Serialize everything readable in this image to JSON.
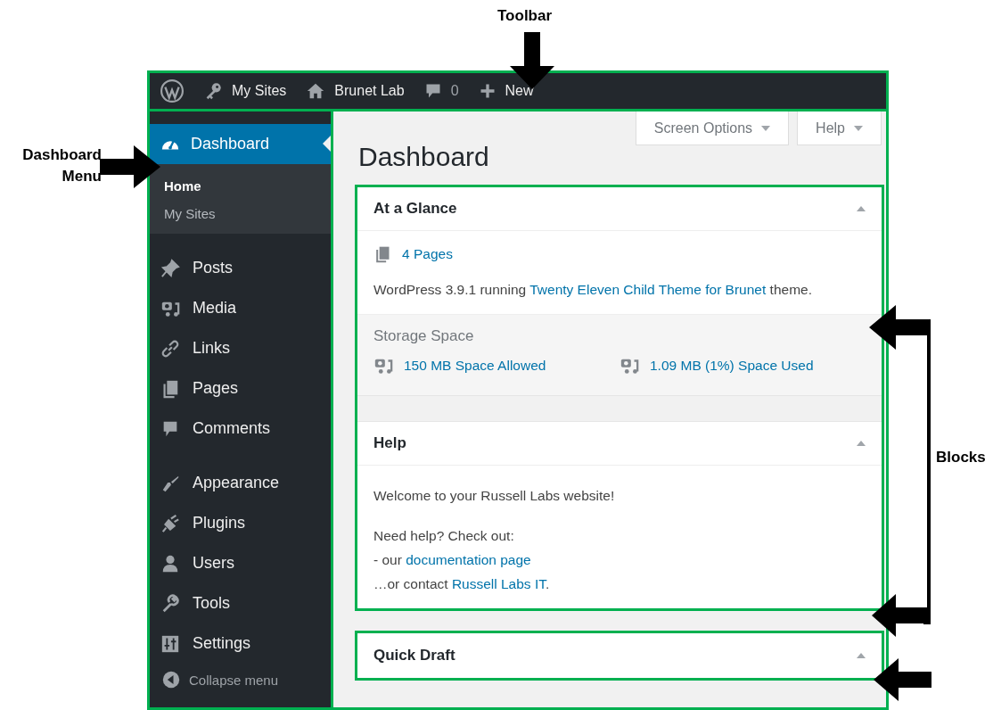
{
  "annotations": {
    "toolbar": "Toolbar",
    "menu": "Dashboard Menu",
    "blocks": "Blocks"
  },
  "toolbar": [
    {
      "kind": "logo"
    },
    {
      "kind": "sites",
      "label": "My Sites"
    },
    {
      "kind": "home",
      "label": "Brunet Lab"
    },
    {
      "kind": "comments",
      "label": "0"
    },
    {
      "kind": "new",
      "label": "New"
    }
  ],
  "sidebar": {
    "current": {
      "label": "Dashboard",
      "submenu": [
        {
          "label": "Home",
          "selected": true
        },
        {
          "label": "My Sites",
          "selected": false
        }
      ]
    },
    "groups": [
      [
        {
          "kind": "pin",
          "label": "Posts"
        },
        {
          "kind": "media",
          "label": "Media"
        },
        {
          "kind": "link",
          "label": "Links"
        },
        {
          "kind": "pages",
          "label": "Pages"
        },
        {
          "kind": "comment",
          "label": "Comments"
        }
      ],
      [
        {
          "kind": "brush",
          "label": "Appearance"
        },
        {
          "kind": "plug",
          "label": "Plugins"
        },
        {
          "kind": "user",
          "label": "Users"
        },
        {
          "kind": "wrench",
          "label": "Tools"
        },
        {
          "kind": "sliders",
          "label": "Settings"
        }
      ]
    ],
    "collapse": "Collapse menu"
  },
  "screen_tabs": [
    "Screen Options",
    "Help"
  ],
  "title": "Dashboard",
  "blocks": [
    {
      "kind": "glance",
      "title": "At a Glance",
      "pages": "4 Pages",
      "version": {
        "before": "WordPress 3.9.1 running ",
        "link": "Twenty Eleven Child Theme for Brunet",
        "after": " theme."
      },
      "storage": {
        "title": "Storage Space",
        "items": [
          "150 MB Space Allowed",
          "1.09 MB (1%) Space Used"
        ]
      }
    },
    {
      "kind": "help",
      "title": "Help",
      "welcome": "Welcome to your Russell Labs website!",
      "lines": [
        {
          "before": "Need help? Check out:"
        },
        {
          "before": "- our ",
          "link": "documentation page"
        },
        {
          "before": "…or contact ",
          "link": "Russell Labs IT",
          "after": "."
        }
      ]
    },
    {
      "kind": "draft",
      "title": "Quick Draft"
    }
  ]
}
